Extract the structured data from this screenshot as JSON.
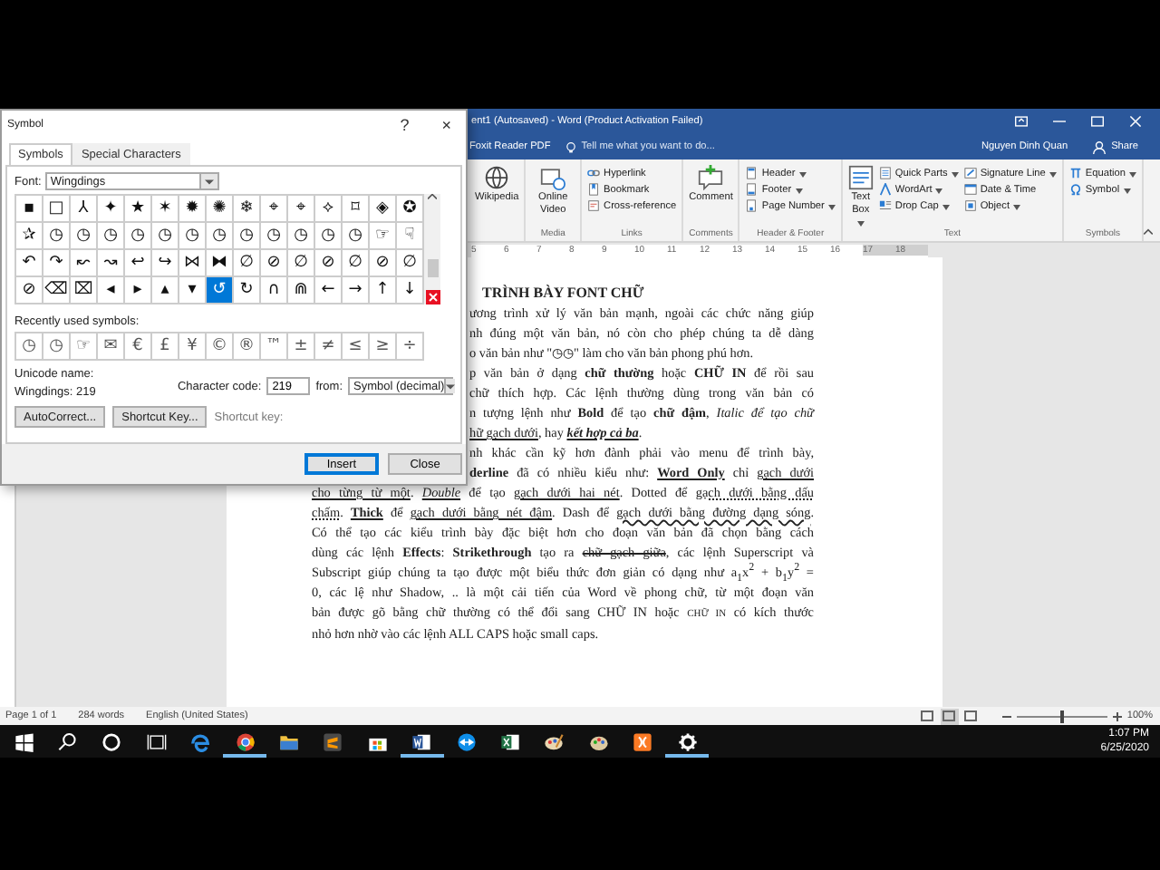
{
  "symbol_dialog": {
    "title": "Symbol",
    "help": "?",
    "close": "×",
    "tabs": [
      {
        "label": "Symbols",
        "selected": true
      },
      {
        "label": "Special Characters",
        "selected": false
      }
    ],
    "font_label": "Font:",
    "font_value": "Wingdings",
    "grid": [
      [
        {
          "char": "▪",
          "selected": false
        },
        {
          "char": "□",
          "selected": false
        },
        {
          "char": "⅄",
          "selected": false
        },
        {
          "char": "✦",
          "selected": false
        },
        {
          "char": "★",
          "selected": false
        },
        {
          "char": "✶",
          "selected": false
        },
        {
          "char": "✹",
          "selected": false
        },
        {
          "char": "✺",
          "selected": false
        },
        {
          "char": "❄",
          "selected": false
        },
        {
          "char": "⌖",
          "selected": false
        },
        {
          "char": "⌖",
          "selected": false
        },
        {
          "char": "⟡",
          "selected": false
        },
        {
          "char": "⌑",
          "selected": false
        },
        {
          "char": "◈",
          "selected": false
        },
        {
          "char": "✪",
          "selected": false
        }
      ],
      [
        {
          "char": "✰",
          "selected": false
        },
        {
          "char": "◷",
          "selected": false
        },
        {
          "char": "◷",
          "selected": false
        },
        {
          "char": "◷",
          "selected": false
        },
        {
          "char": "◷",
          "selected": false
        },
        {
          "char": "◷",
          "selected": false
        },
        {
          "char": "◷",
          "selected": false
        },
        {
          "char": "◷",
          "selected": false
        },
        {
          "char": "◷",
          "selected": false
        },
        {
          "char": "◷",
          "selected": false
        },
        {
          "char": "◷",
          "selected": false
        },
        {
          "char": "◷",
          "selected": false
        },
        {
          "char": "◷",
          "selected": false
        },
        {
          "char": "☞",
          "selected": false
        },
        {
          "char": "☟",
          "selected": false
        }
      ],
      [
        {
          "char": "↶",
          "selected": false
        },
        {
          "char": "↷",
          "selected": false
        },
        {
          "char": "↜",
          "selected": false
        },
        {
          "char": "↝",
          "selected": false
        },
        {
          "char": "↩",
          "selected": false
        },
        {
          "char": "↪",
          "selected": false
        },
        {
          "char": "⋈",
          "selected": false
        },
        {
          "char": "⧓",
          "selected": false
        },
        {
          "char": "∅",
          "selected": false
        },
        {
          "char": "⊘",
          "selected": false
        },
        {
          "char": "∅",
          "selected": false
        },
        {
          "char": "⊘",
          "selected": false
        },
        {
          "char": "∅",
          "selected": false
        },
        {
          "char": "⊘",
          "selected": false
        },
        {
          "char": "∅",
          "selected": false
        }
      ],
      [
        {
          "char": "⊘",
          "selected": false
        },
        {
          "char": "⌫",
          "selected": false
        },
        {
          "char": "⌧",
          "selected": false
        },
        {
          "char": "◂",
          "selected": false
        },
        {
          "char": "▸",
          "selected": false
        },
        {
          "char": "▴",
          "selected": false
        },
        {
          "char": "▾",
          "selected": false
        },
        {
          "char": "↺",
          "selected": true
        },
        {
          "char": "↻",
          "selected": false
        },
        {
          "char": "∩",
          "selected": false
        },
        {
          "char": "⋒",
          "selected": false
        },
        {
          "char": "←",
          "selected": false
        },
        {
          "char": "→",
          "selected": false
        },
        {
          "char": "↑",
          "selected": false
        },
        {
          "char": "↓",
          "selected": false
        }
      ]
    ],
    "recent_label": "Recently used symbols:",
    "recent": [
      "◷",
      "◷",
      "☞",
      "✉",
      "€",
      "£",
      "¥",
      "©",
      "®",
      "™",
      "±",
      "≠",
      "≤",
      "≥",
      "÷"
    ],
    "unicode_name_label": "Unicode name:",
    "unicode_name": "Wingdings: 219",
    "char_code_label": "Character code:",
    "char_code": "219",
    "from_label": "from:",
    "from_value": "Symbol (decimal)",
    "buttons": [
      "AutoCorrect...",
      "Shortcut Key..."
    ],
    "shortcut_label": "Shortcut key:",
    "footer_buttons": [
      {
        "label": "Insert",
        "default": true
      },
      {
        "label": "Close",
        "default": false
      }
    ]
  },
  "word": {
    "title": "ent1 (Autosaved) - Word (Product Activation Failed)",
    "tab": "Foxit Reader PDF",
    "tell_me": "Tell me what you want to do...",
    "user": "Nguyen Dinh Quan",
    "share": "Share",
    "ribbon": [
      {
        "items": [
          {
            "label": "Wikipedia",
            "kind": "large",
            "dropdown": false
          }
        ]
      },
      {
        "label": "Media",
        "items": [
          {
            "label": "Online Video",
            "kind": "large",
            "dropdown": false
          }
        ]
      },
      {
        "label": "Links",
        "items": [
          {
            "label": "Hyperlink",
            "kind": "small",
            "dropdown": false
          },
          {
            "label": "Bookmark",
            "kind": "small",
            "dropdown": false
          },
          {
            "label": "Cross-reference",
            "kind": "small",
            "dropdown": false
          }
        ]
      },
      {
        "label": "Comments",
        "items": [
          {
            "label": "Comment",
            "kind": "large",
            "dropdown": false
          }
        ]
      },
      {
        "label": "Header & Footer",
        "items": [
          {
            "label": "Header",
            "kind": "small",
            "dropdown": true
          },
          {
            "label": "Footer",
            "kind": "small",
            "dropdown": true
          },
          {
            "label": "Page Number",
            "kind": "small",
            "dropdown": true
          }
        ]
      },
      {
        "label": "Text",
        "items": [
          {
            "label": "Text Box",
            "kind": "large",
            "dropdown": true
          },
          {
            "label": "Quick Parts",
            "kind": "small",
            "dropdown": true
          },
          {
            "label": "WordArt",
            "kind": "small",
            "dropdown": true
          },
          {
            "label": "Drop Cap",
            "kind": "small",
            "dropdown": true
          },
          {
            "label": "Signature Line",
            "kind": "small",
            "dropdown": true
          },
          {
            "label": "Date & Time",
            "kind": "small",
            "dropdown": false
          },
          {
            "label": "Object",
            "kind": "small",
            "dropdown": true
          }
        ]
      },
      {
        "label": "Symbols",
        "items": [
          {
            "label": "Equation",
            "kind": "small",
            "dropdown": true
          },
          {
            "label": "Symbol",
            "kind": "small",
            "dropdown": true
          }
        ]
      }
    ],
    "ruler": [
      "5",
      "6",
      "7",
      "8",
      "9",
      "10",
      "11",
      "12",
      "13",
      "14",
      "15",
      "16",
      "17",
      "18"
    ],
    "document": {
      "heading": "TRÌNH BÀY FONT CHỮ",
      "lines": [
        {
          "paragraph_end": false,
          "runs": [
            {
              "kind": "plain",
              "text": "ương trình xử lý văn bản mạnh, ngoài các chức năng giúp"
            }
          ]
        },
        {
          "paragraph_end": false,
          "runs": [
            {
              "kind": "plain",
              "text": "nh đúng một văn bản, nó còn cho phép chúng ta dễ dàng"
            }
          ]
        },
        {
          "paragraph_end": true,
          "runs": [
            {
              "kind": "plain",
              "text": "o văn bản như \"◷◷\" làm cho văn bản phong phú hơn."
            }
          ]
        },
        {
          "paragraph_end": false,
          "runs": [
            {
              "kind": "plain",
              "text": "p văn bản ở dạng "
            },
            {
              "kind": "bold",
              "text": "chữ thường"
            },
            {
              "kind": "plain",
              "text": " hoặc "
            },
            {
              "kind": "bold",
              "text": "CHỮ IN"
            },
            {
              "kind": "plain",
              "text": " để rồi sau"
            }
          ]
        },
        {
          "paragraph_end": false,
          "runs": [
            {
              "kind": "plain",
              "text": "chữ thích hợp. Các lệnh thường dùng trong văn bản có"
            }
          ]
        },
        {
          "paragraph_end": false,
          "runs": [
            {
              "kind": "plain",
              "text": "n tượng lệnh như "
            },
            {
              "kind": "bold",
              "text": "Bold"
            },
            {
              "kind": "plain",
              "text": " để tạo "
            },
            {
              "kind": "bold",
              "text": "chữ đậm"
            },
            {
              "kind": "plain",
              "text": ", "
            },
            {
              "kind": "italic",
              "text": "Italic để tạo chữ"
            }
          ]
        },
        {
          "paragraph_end": true,
          "runs": [
            {
              "kind": "underline",
              "text": "hữ gạch dưới"
            },
            {
              "kind": "plain",
              "text": ", hay "
            },
            {
              "kind": "bold-italic-underline",
              "text": "kết hợp cả ba"
            },
            {
              "kind": "plain",
              "text": "."
            }
          ]
        },
        {
          "paragraph_end": false,
          "runs": [
            {
              "kind": "plain",
              "text": "nh khác cần kỹ hơn đành phải vào menu để trình bày,"
            }
          ]
        },
        {
          "paragraph_end": false,
          "runs": [
            {
              "kind": "bold",
              "text": "derline"
            },
            {
              "kind": "plain",
              "text": " đã có nhiều kiểu như: "
            },
            {
              "kind": "bold-underline",
              "text": "Word Only"
            },
            {
              "kind": "plain",
              "text": " chỉ "
            },
            {
              "kind": "underline",
              "text": "gạch dưới"
            }
          ]
        },
        {
          "paragraph_end": false,
          "runs": [
            {
              "kind": "underline",
              "text": "cho từng từ một"
            },
            {
              "kind": "plain",
              "text": ". "
            },
            {
              "kind": "italic-underline",
              "text": "Double"
            },
            {
              "kind": "plain",
              "text": " để tạo "
            },
            {
              "kind": "underline",
              "text": "gạch dưới hai nét"
            },
            {
              "kind": "plain",
              "text": ". Dotted để "
            },
            {
              "kind": "dotted",
              "text": "gạch dưới bằng dấu"
            }
          ]
        },
        {
          "paragraph_end": false,
          "runs": [
            {
              "kind": "dotted",
              "text": "chấm"
            },
            {
              "kind": "plain",
              "text": ". "
            },
            {
              "kind": "bold-underline",
              "text": "Thick"
            },
            {
              "kind": "plain",
              "text": " để "
            },
            {
              "kind": "underline",
              "text": "gạch dưới bằng nét đậm"
            },
            {
              "kind": "plain",
              "text": ". Dash để "
            },
            {
              "kind": "wavy",
              "text": "gạch dưới bằng đường dạng sóng"
            },
            {
              "kind": "plain",
              "text": "."
            }
          ]
        },
        {
          "paragraph_end": false,
          "runs": [
            {
              "kind": "plain",
              "text": "Có thể tạo các kiểu trình bày đặc biệt hơn cho đoạn văn bản đã chọn bằng cách"
            }
          ]
        },
        {
          "paragraph_end": false,
          "runs": [
            {
              "kind": "plain",
              "text": "dùng các lệnh "
            },
            {
              "kind": "bold",
              "text": "Effects"
            },
            {
              "kind": "plain",
              "text": ": "
            },
            {
              "kind": "bold",
              "text": "Strikethrough"
            },
            {
              "kind": "plain",
              "text": " tạo ra "
            },
            {
              "kind": "strike",
              "text": "chữ gạch giữa"
            },
            {
              "kind": "plain",
              "text": ", các lệnh Superscript và"
            }
          ]
        },
        {
          "paragraph_end": false,
          "runs": [
            {
              "kind": "plain",
              "text": "Subscript giúp chúng ta tạo được một biểu thức đơn giản có dạng như a$_{1}$x$^{2}$ + b$_{1}$y$^{2}$ ="
            }
          ]
        },
        {
          "paragraph_end": false,
          "runs": [
            {
              "kind": "plain",
              "text": "0, các lệ như Shadow, .. là một cải tiến của Word về phong chữ, từ một đoạn văn"
            }
          ]
        },
        {
          "paragraph_end": false,
          "runs": [
            {
              "kind": "plain",
              "text": "bản được gõ bằng chữ thường có thể đổi sang CHỮ IN hoặc "
            },
            {
              "kind": "small",
              "text": "CHỮ IN"
            },
            {
              "kind": "plain",
              "text": " có kích  thước"
            }
          ]
        },
        {
          "paragraph_end": true,
          "runs": [
            {
              "kind": "plain",
              "text": "nhỏ hơn nhờ vào các lệnh ALL CAPS hoặc small caps."
            }
          ]
        }
      ]
    },
    "status": {
      "page": "Page 1 of 1",
      "words": "284 words",
      "language": "English (United States)",
      "views": [
        {
          "selected": false
        },
        {
          "selected": true
        },
        {
          "selected": false
        }
      ],
      "zoom": {
        "level": 0.5,
        "label": "100%"
      }
    }
  },
  "taskbar": {
    "items": [
      {
        "running": false
      },
      {
        "running": false
      },
      {
        "running": false
      },
      {
        "running": false
      },
      {
        "running": false
      },
      {
        "running": true
      },
      {
        "running": false
      },
      {
        "running": false
      },
      {
        "running": false
      },
      {
        "running": true
      },
      {
        "running": false
      },
      {
        "running": false
      },
      {
        "running": false
      },
      {
        "running": false
      },
      {
        "running": false
      },
      {
        "running": true
      }
    ],
    "time": "1:07 PM",
    "date": "6/25/2020"
  }
}
